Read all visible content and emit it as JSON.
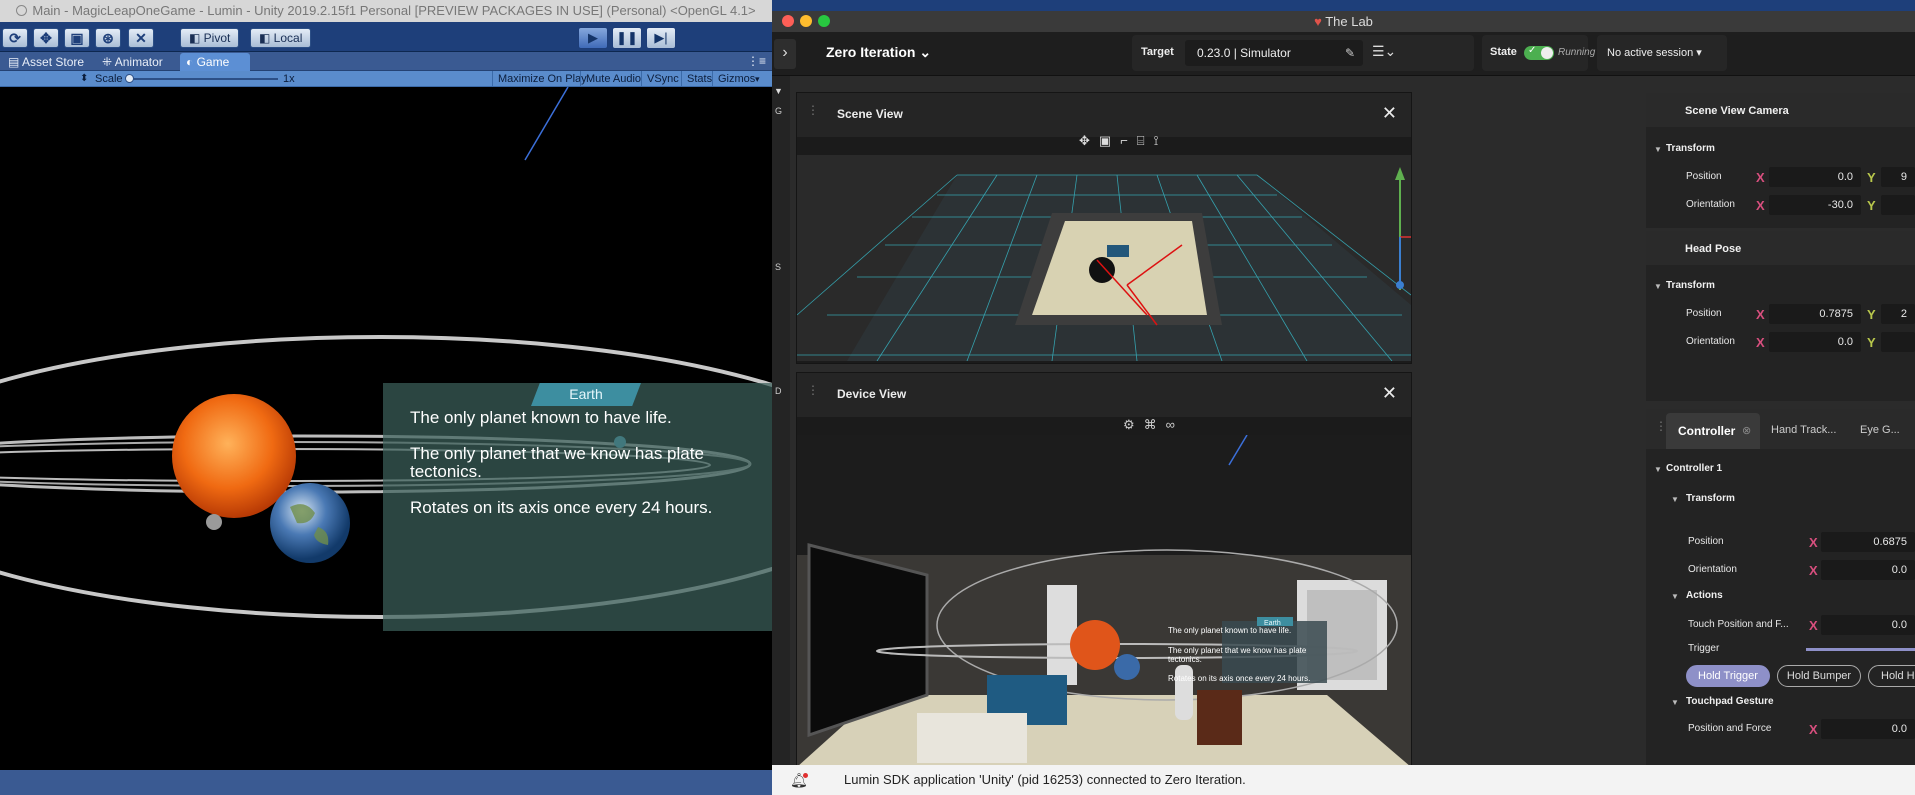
{
  "unity": {
    "window_title": "Main - MagicLeapOneGame - Lumin - Unity 2019.2.15f1 Personal [PREVIEW PACKAGES IN USE] (Personal) <OpenGL 4.1>",
    "pivot_label": "Pivot",
    "local_label": "Local",
    "tabs": [
      "Asset Store",
      "Animator",
      "Game"
    ],
    "scale_label": "Scale",
    "scale_value": "1x",
    "game_bar": {
      "maximize": "Maximize On Play",
      "mute": "Mute Audio",
      "vsync": "VSync",
      "stats": "Stats",
      "gizmos": "Gizmos"
    },
    "info_panel": {
      "title": "Earth",
      "lines": [
        "The only planet known to have life.",
        "The only planet that we know has plate",
        "tectonics.",
        "Rotates on its axis once every 24 hours."
      ]
    }
  },
  "lab": {
    "window_title": "The Lab",
    "zero_iteration": "Zero Iteration",
    "target_label": "Target",
    "target_value": "0.23.0 | Simulator",
    "state_label": "State",
    "state_value": "Running",
    "session": "No active session",
    "scene_view_title": "Scene View",
    "device_view_title": "Device View",
    "scene_camera": {
      "title": "Scene View Camera",
      "transform": "Transform",
      "position_label": "Position",
      "orientation_label": "Orientation",
      "position_x": "0.0",
      "position_y": "9",
      "orientation_x": "-30.0"
    },
    "head_pose": {
      "title": "Head Pose",
      "transform": "Transform",
      "position_label": "Position",
      "orientation_label": "Orientation",
      "position_x": "0.7875",
      "position_y": "2",
      "orientation_x": "0.0"
    },
    "bottom_tabs": [
      "Controller",
      "Hand Track...",
      "Eye G..."
    ],
    "controller": {
      "title": "Controller 1",
      "transform": "Transform",
      "position_label": "Position",
      "position_x": "0.6875",
      "orientation_label": "Orientation",
      "orientation_x": "0.0",
      "actions": "Actions",
      "touch_label": "Touch Position and F...",
      "touch_x": "0.0",
      "trigger": "Trigger",
      "buttons": [
        "Hold Trigger",
        "Hold Bumper",
        "Hold H"
      ],
      "touchpad": "Touchpad Gesture",
      "pos_force": "Position and Force",
      "pos_force_x": "0.0"
    },
    "side_letters": [
      "G",
      "S",
      "D"
    ],
    "status_message": "Lumin SDK application 'Unity' (pid 16253) connected to Zero Iteration."
  },
  "colors": {
    "unity_toolbar": "#1e3f7a",
    "accent_blue": "#5c8fd4",
    "running_green": "#4caf50",
    "x_axis": "#d84f7e",
    "y_axis": "#b9c84c",
    "selected_pill": "#8e90c8"
  }
}
